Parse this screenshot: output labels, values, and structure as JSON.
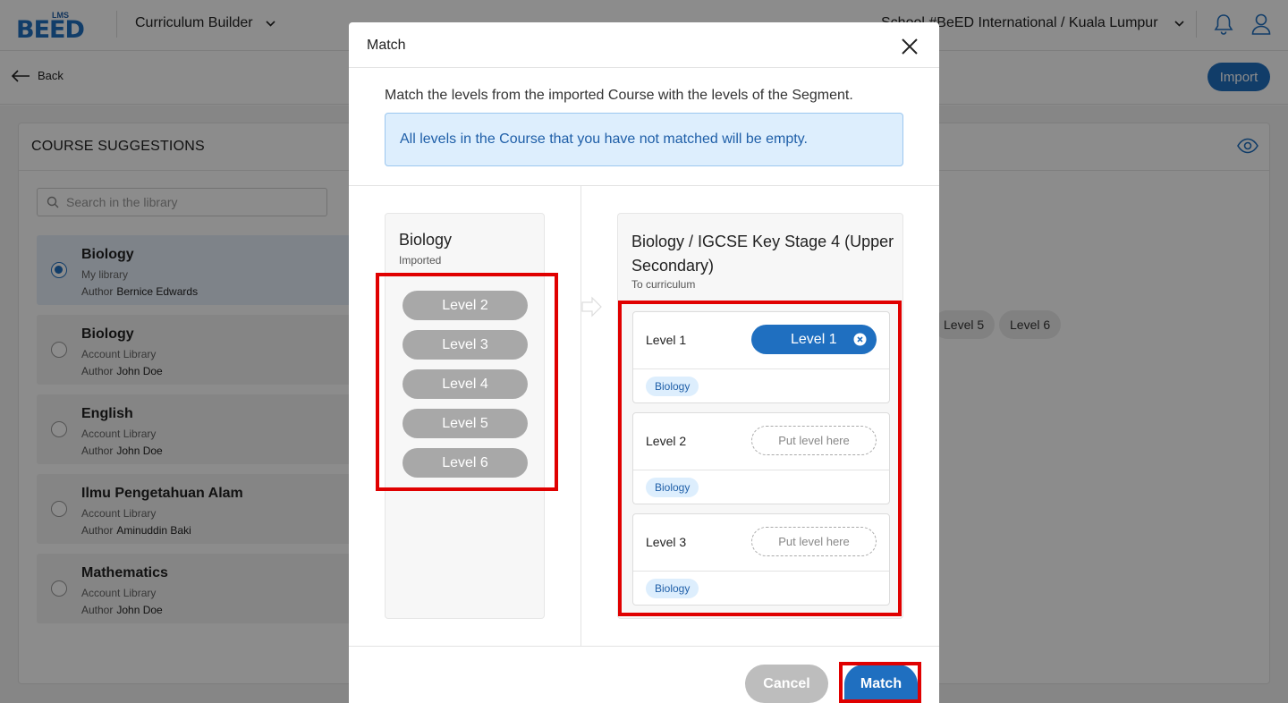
{
  "header": {
    "logo_small": "LMS",
    "logo_word": "BEED",
    "app_menu": "Curriculum Builder",
    "school": "School #BeED International / Kuala Lumpur"
  },
  "subbar": {
    "back": "Back",
    "import": "Import"
  },
  "panel": {
    "title": "COURSE SUGGESTIONS",
    "search_placeholder": "Search in the library",
    "author_label": "Author",
    "courses": [
      {
        "name": "Biology",
        "library": "My library",
        "author": "Bernice Edwards",
        "selected": true
      },
      {
        "name": "Biology",
        "library": "Account Library",
        "author": "John Doe",
        "selected": false
      },
      {
        "name": "English",
        "library": "Account Library",
        "author": "John Doe",
        "selected": false
      },
      {
        "name": "Ilmu Pengetahuan Alam",
        "library": "Account Library",
        "author": "Aminuddin Baki",
        "selected": false
      },
      {
        "name": "Mathematics",
        "library": "Account Library",
        "author": "John Doe",
        "selected": false
      }
    ],
    "bg_chips": [
      "Level 5",
      "Level 6"
    ]
  },
  "modal": {
    "title": "Match",
    "description": "Match the levels from the imported Course with the levels of the Segment.",
    "info": "All levels in the Course that you have not matched will be empty.",
    "source": {
      "title": "Biology",
      "subtitle": "Imported",
      "levels": [
        "Level 2",
        "Level 3",
        "Level 4",
        "Level 5",
        "Level 6"
      ]
    },
    "target": {
      "title": "Biology / IGCSE Key Stage 4 (Upper Secondary)",
      "subtitle": "To curriculum",
      "slots": [
        {
          "label": "Level 1",
          "assigned": "Level 1",
          "tag": "Biology"
        },
        {
          "label": "Level 2",
          "placeholder": "Put level here",
          "tag": "Biology"
        },
        {
          "label": "Level 3",
          "placeholder": "Put level here",
          "tag": "Biology"
        }
      ]
    },
    "cancel": "Cancel",
    "match": "Match"
  },
  "colors": {
    "primary": "#1f6fc0",
    "highlight": "#e00000",
    "info_bg": "#ddeefd"
  }
}
